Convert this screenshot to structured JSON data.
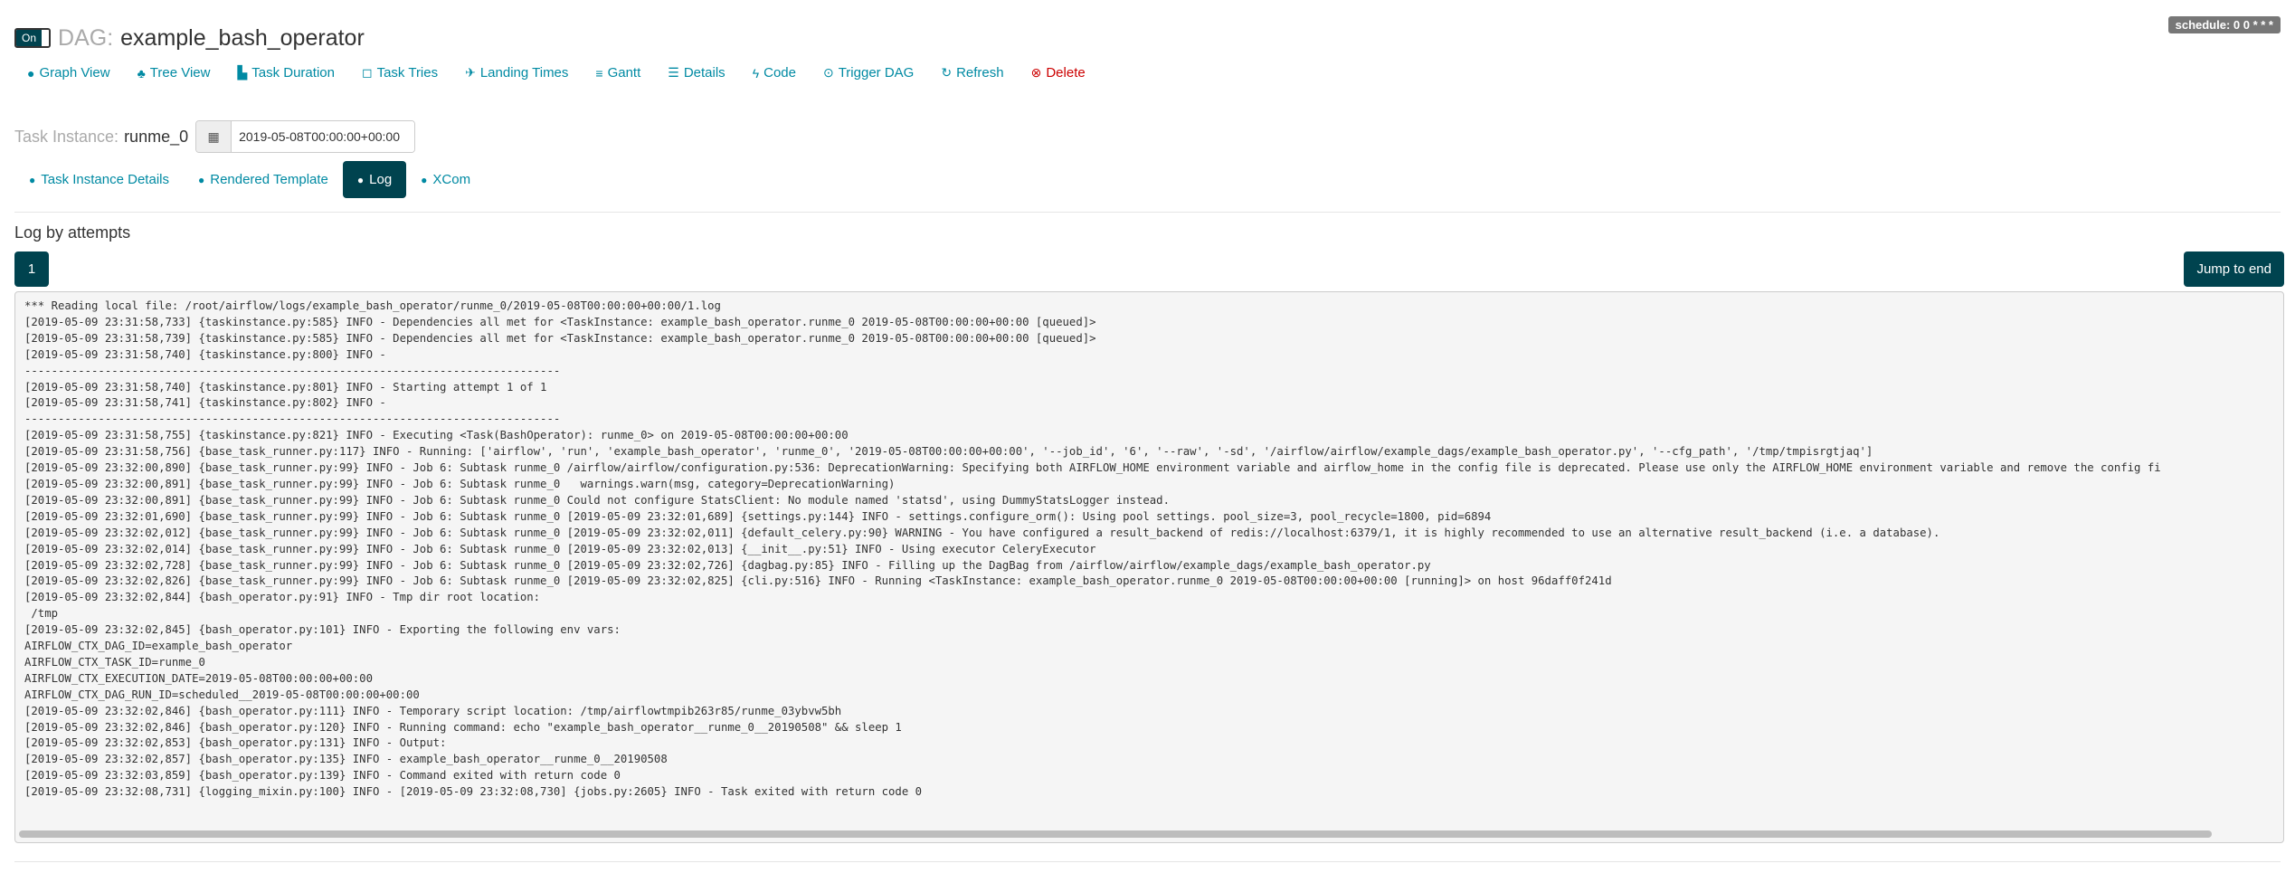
{
  "header": {
    "toggle_label": "On",
    "dag_prefix": "DAG:",
    "dag_id": "example_bash_operator",
    "schedule_badge": "schedule: 0 0 * * *"
  },
  "nav": [
    {
      "label": "Graph View",
      "icon": "●",
      "name": "graph-view"
    },
    {
      "label": "Tree View",
      "icon": "♣",
      "name": "tree-view"
    },
    {
      "label": "Task Duration",
      "icon": "▙",
      "name": "task-duration"
    },
    {
      "label": "Task Tries",
      "icon": "◻",
      "name": "task-tries"
    },
    {
      "label": "Landing Times",
      "icon": "✈",
      "name": "landing-times"
    },
    {
      "label": "Gantt",
      "icon": "≡",
      "name": "gantt"
    },
    {
      "label": "Details",
      "icon": "☰",
      "name": "details"
    },
    {
      "label": "Code",
      "icon": "ϟ",
      "name": "code"
    },
    {
      "label": "Trigger DAG",
      "icon": "⊙",
      "name": "trigger-dag"
    },
    {
      "label": "Refresh",
      "icon": "↻",
      "name": "refresh"
    },
    {
      "label": "Delete",
      "icon": "⊗",
      "name": "delete"
    }
  ],
  "task_instance": {
    "label": "Task Instance:",
    "id": "runme_0",
    "execution_date": "2019-05-08T00:00:00+00:00"
  },
  "tabs": [
    {
      "label": "Task Instance Details",
      "name": "task-instance-details",
      "active": false
    },
    {
      "label": "Rendered Template",
      "name": "rendered-template",
      "active": false
    },
    {
      "label": "Log",
      "name": "log",
      "active": true
    },
    {
      "label": "XCom",
      "name": "xcom",
      "active": false
    }
  ],
  "log_section": {
    "title": "Log by attempts",
    "attempt": "1",
    "jump_label": "Jump to end"
  },
  "log_lines": [
    "*** Reading local file: /root/airflow/logs/example_bash_operator/runme_0/2019-05-08T00:00:00+00:00/1.log",
    "[2019-05-09 23:31:58,733] {taskinstance.py:585} INFO - Dependencies all met for <TaskInstance: example_bash_operator.runme_0 2019-05-08T00:00:00+00:00 [queued]>",
    "[2019-05-09 23:31:58,739] {taskinstance.py:585} INFO - Dependencies all met for <TaskInstance: example_bash_operator.runme_0 2019-05-08T00:00:00+00:00 [queued]>",
    "[2019-05-09 23:31:58,740] {taskinstance.py:800} INFO - ",
    "--------------------------------------------------------------------------------",
    "[2019-05-09 23:31:58,740] {taskinstance.py:801} INFO - Starting attempt 1 of 1",
    "[2019-05-09 23:31:58,741] {taskinstance.py:802} INFO - ",
    "--------------------------------------------------------------------------------",
    "[2019-05-09 23:31:58,755] {taskinstance.py:821} INFO - Executing <Task(BashOperator): runme_0> on 2019-05-08T00:00:00+00:00",
    "[2019-05-09 23:31:58,756] {base_task_runner.py:117} INFO - Running: ['airflow', 'run', 'example_bash_operator', 'runme_0', '2019-05-08T00:00:00+00:00', '--job_id', '6', '--raw', '-sd', '/airflow/airflow/example_dags/example_bash_operator.py', '--cfg_path', '/tmp/tmpisrgtjaq']",
    "[2019-05-09 23:32:00,890] {base_task_runner.py:99} INFO - Job 6: Subtask runme_0 /airflow/airflow/configuration.py:536: DeprecationWarning: Specifying both AIRFLOW_HOME environment variable and airflow_home in the config file is deprecated. Please use only the AIRFLOW_HOME environment variable and remove the config fi",
    "[2019-05-09 23:32:00,891] {base_task_runner.py:99} INFO - Job 6: Subtask runme_0   warnings.warn(msg, category=DeprecationWarning)",
    "[2019-05-09 23:32:00,891] {base_task_runner.py:99} INFO - Job 6: Subtask runme_0 Could not configure StatsClient: No module named 'statsd', using DummyStatsLogger instead.",
    "[2019-05-09 23:32:01,690] {base_task_runner.py:99} INFO - Job 6: Subtask runme_0 [2019-05-09 23:32:01,689] {settings.py:144} INFO - settings.configure_orm(): Using pool settings. pool_size=3, pool_recycle=1800, pid=6894",
    "[2019-05-09 23:32:02,012] {base_task_runner.py:99} INFO - Job 6: Subtask runme_0 [2019-05-09 23:32:02,011] {default_celery.py:90} WARNING - You have configured a result_backend of redis://localhost:6379/1, it is highly recommended to use an alternative result_backend (i.e. a database).",
    "[2019-05-09 23:32:02,014] {base_task_runner.py:99} INFO - Job 6: Subtask runme_0 [2019-05-09 23:32:02,013] {__init__.py:51} INFO - Using executor CeleryExecutor",
    "[2019-05-09 23:32:02,728] {base_task_runner.py:99} INFO - Job 6: Subtask runme_0 [2019-05-09 23:32:02,726] {dagbag.py:85} INFO - Filling up the DagBag from /airflow/airflow/example_dags/example_bash_operator.py",
    "[2019-05-09 23:32:02,826] {base_task_runner.py:99} INFO - Job 6: Subtask runme_0 [2019-05-09 23:32:02,825] {cli.py:516} INFO - Running <TaskInstance: example_bash_operator.runme_0 2019-05-08T00:00:00+00:00 [running]> on host 96daff0f241d",
    "[2019-05-09 23:32:02,844] {bash_operator.py:91} INFO - Tmp dir root location: ",
    " /tmp",
    "[2019-05-09 23:32:02,845] {bash_operator.py:101} INFO - Exporting the following env vars:",
    "AIRFLOW_CTX_DAG_ID=example_bash_operator",
    "AIRFLOW_CTX_TASK_ID=runme_0",
    "AIRFLOW_CTX_EXECUTION_DATE=2019-05-08T00:00:00+00:00",
    "AIRFLOW_CTX_DAG_RUN_ID=scheduled__2019-05-08T00:00:00+00:00",
    "[2019-05-09 23:32:02,846] {bash_operator.py:111} INFO - Temporary script location: /tmp/airflowtmpib263r85/runme_03ybvw5bh",
    "[2019-05-09 23:32:02,846] {bash_operator.py:120} INFO - Running command: echo \"example_bash_operator__runme_0__20190508\" && sleep 1",
    "[2019-05-09 23:32:02,853] {bash_operator.py:131} INFO - Output:",
    "[2019-05-09 23:32:02,857] {bash_operator.py:135} INFO - example_bash_operator__runme_0__20190508",
    "[2019-05-09 23:32:03,859] {bash_operator.py:139} INFO - Command exited with return code 0",
    "[2019-05-09 23:32:08,731] {logging_mixin.py:100} INFO - [2019-05-09 23:32:08,730] {jobs.py:2605} INFO - Task exited with return code 0"
  ]
}
